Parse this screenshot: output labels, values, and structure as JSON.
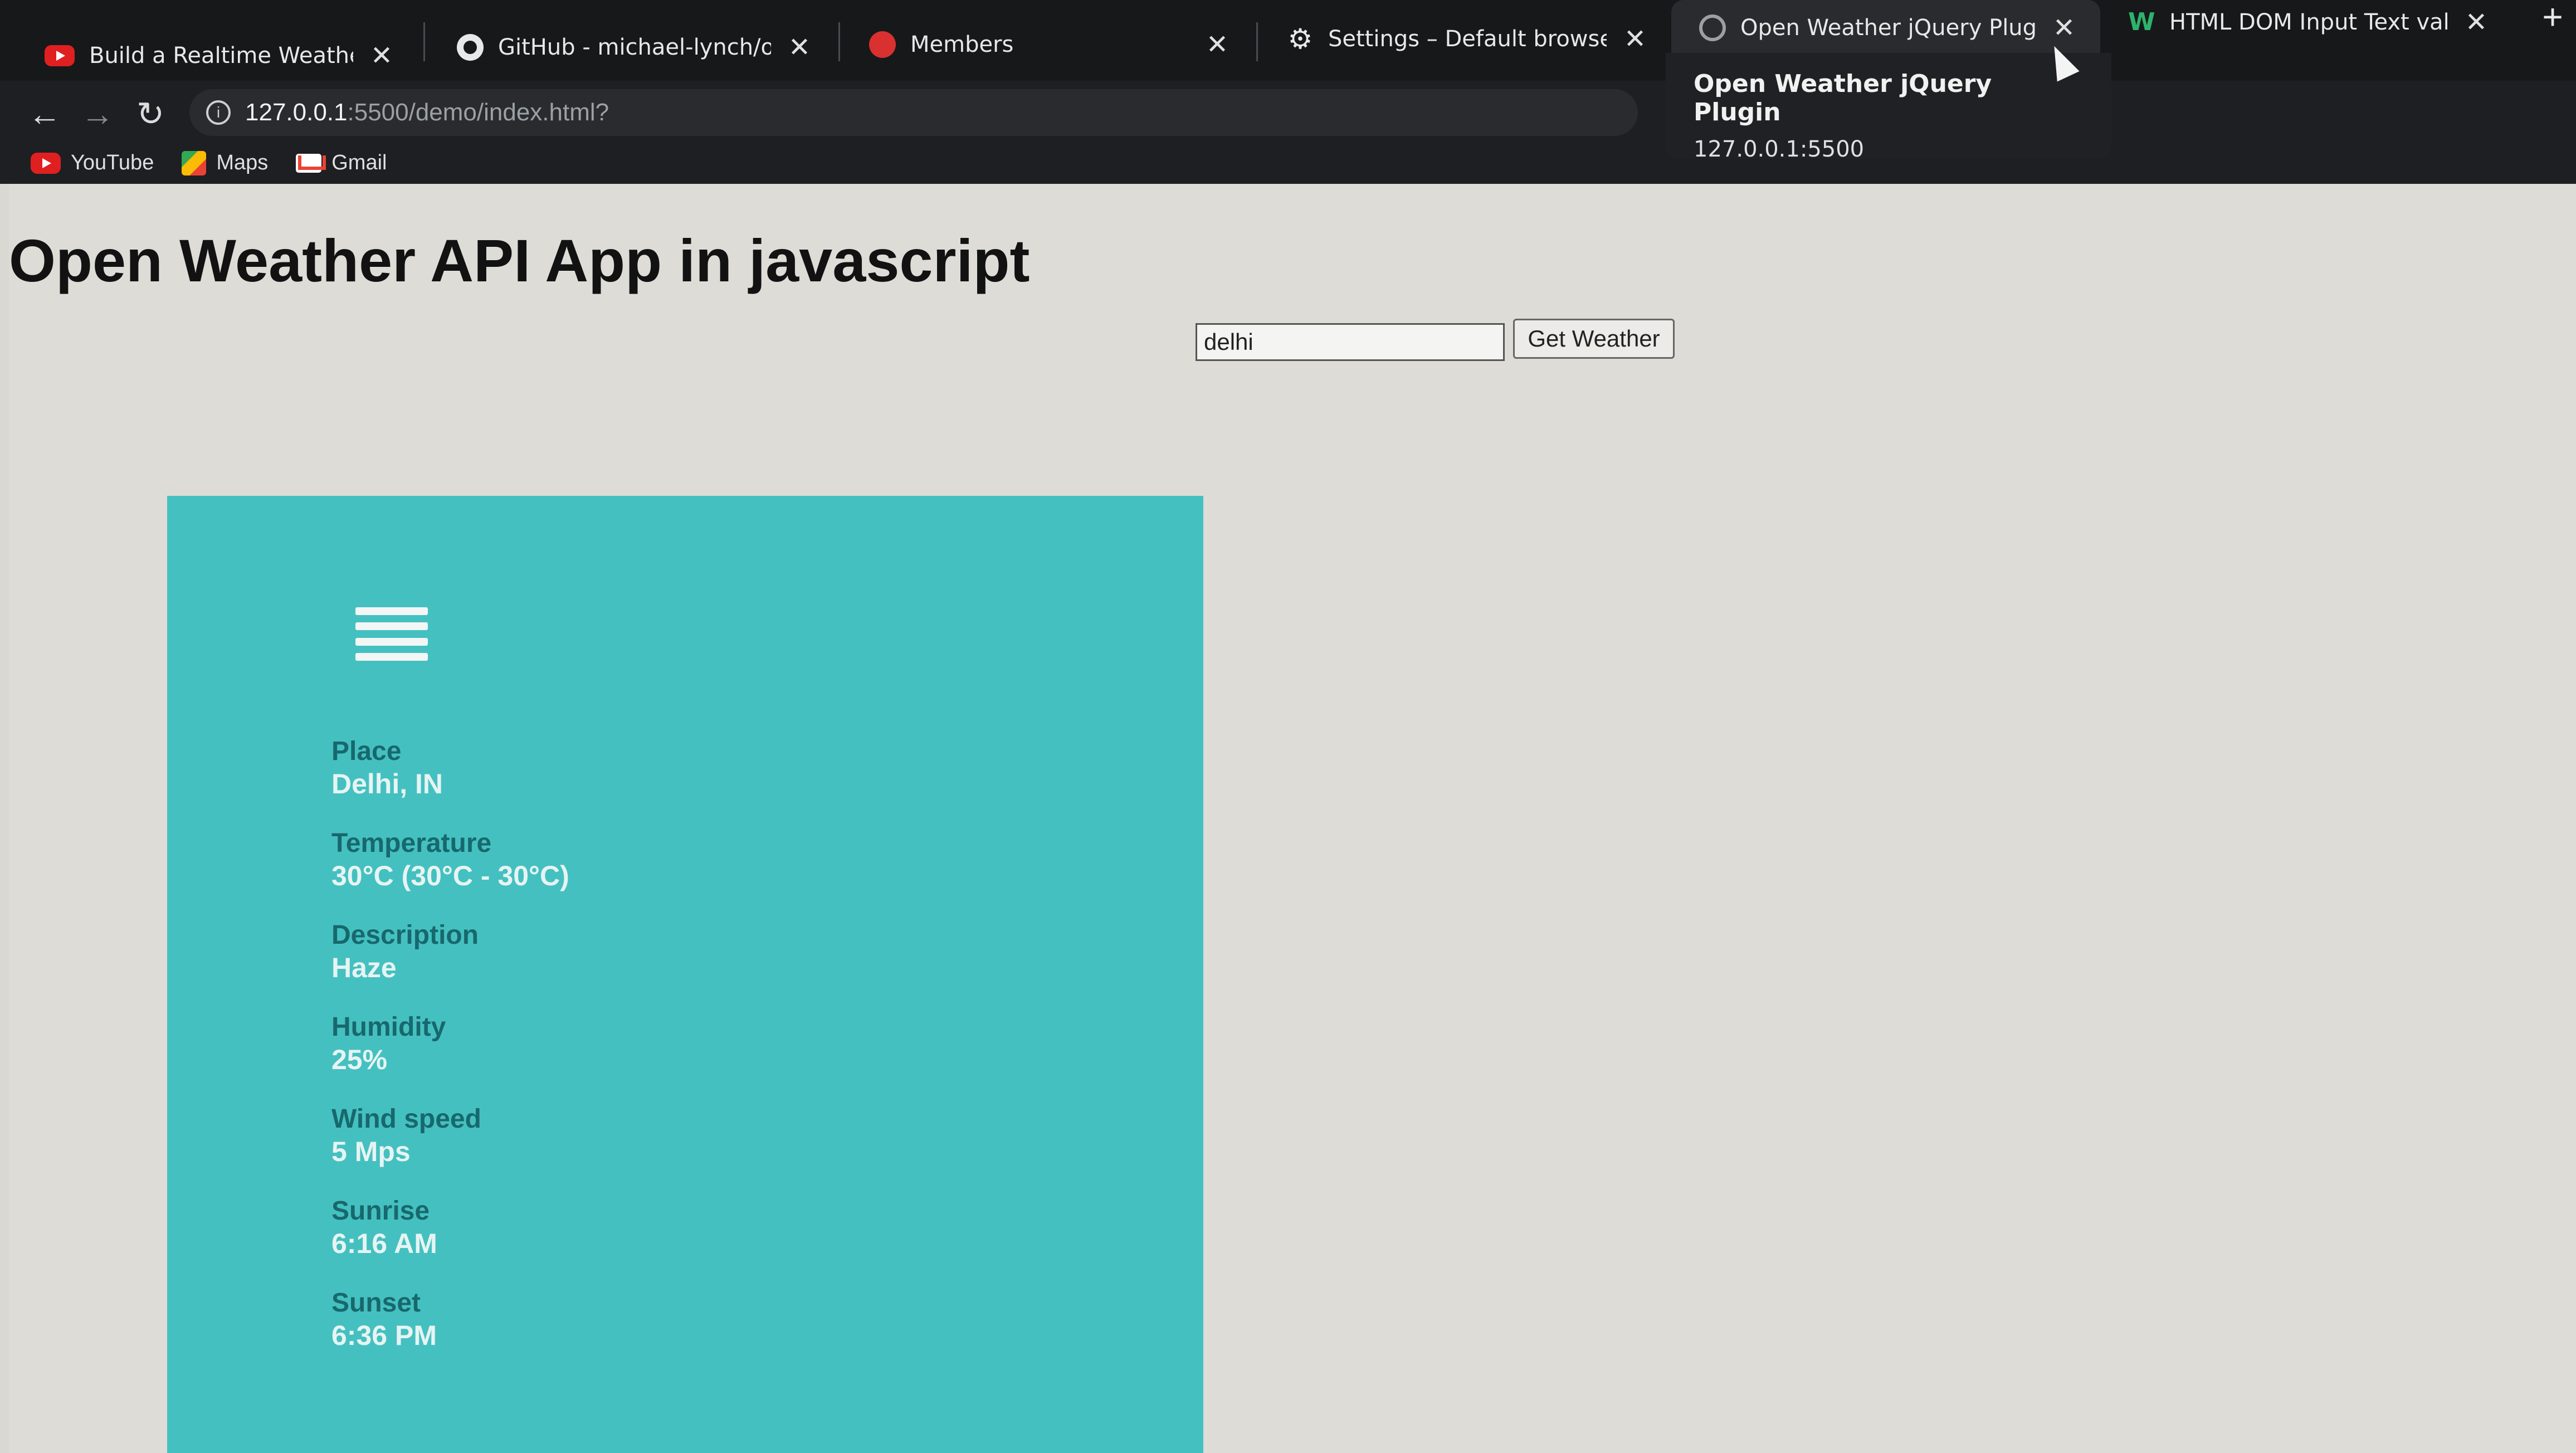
{
  "browser": {
    "tabs": [
      {
        "title": "Build a Realtime Weather App U",
        "icon": "youtube-icon",
        "active": false
      },
      {
        "title": "GitHub - michael-lynch/open-we",
        "icon": "github-icon",
        "active": false
      },
      {
        "title": "Members",
        "icon": "members-icon",
        "active": false
      },
      {
        "title": "Settings – Default browser",
        "icon": "gear-icon",
        "active": false
      },
      {
        "title": "Open Weather jQuery Plugin",
        "icon": "globe-icon",
        "active": true
      },
      {
        "title": "HTML DOM Input Text value Pro",
        "icon": "w3schools-icon",
        "active": false
      }
    ],
    "new_tab": "+",
    "address": {
      "host": "127.0.0.1",
      "path": ":5500/demo/index.html?"
    },
    "bookmarks": [
      {
        "label": "YouTube",
        "icon": "youtube-icon"
      },
      {
        "label": "Maps",
        "icon": "maps-icon"
      },
      {
        "label": "Gmail",
        "icon": "gmail-icon"
      }
    ],
    "hover_card": {
      "title": "Open Weather jQuery Plugin",
      "url": "127.0.0.1:5500"
    }
  },
  "page": {
    "title": "Open Weather API App in javascript",
    "search": {
      "value": "delhi"
    },
    "button_label": "Get Weather"
  },
  "weather": {
    "fields": [
      {
        "label": "Place",
        "value": "Delhi, IN"
      },
      {
        "label": "Temperature",
        "value": "30°C (30°C - 30°C)"
      },
      {
        "label": "Description",
        "value": "Haze"
      },
      {
        "label": "Humidity",
        "value": "25%"
      },
      {
        "label": "Wind speed",
        "value": "5 Mps"
      },
      {
        "label": "Sunrise",
        "value": "6:16 AM"
      },
      {
        "label": "Sunset",
        "value": "6:36 PM"
      }
    ]
  },
  "colors": {
    "card": "#45c0c0",
    "label": "#17686d",
    "value": "#e6f4f3"
  }
}
